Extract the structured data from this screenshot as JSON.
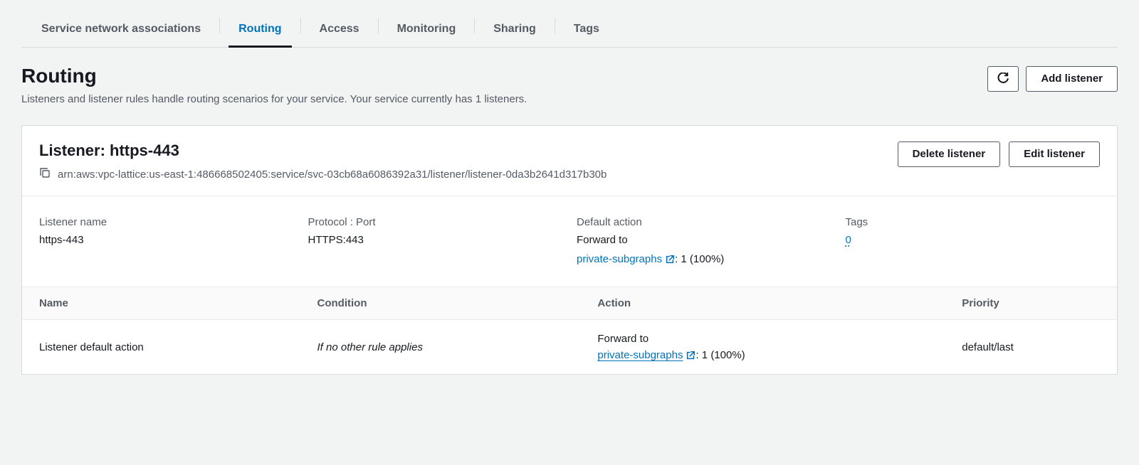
{
  "tabs": {
    "items": [
      {
        "label": "Service network associations"
      },
      {
        "label": "Routing"
      },
      {
        "label": "Access"
      },
      {
        "label": "Monitoring"
      },
      {
        "label": "Sharing"
      },
      {
        "label": "Tags"
      }
    ],
    "active_index": 1
  },
  "section": {
    "title": "Routing",
    "subtitle": "Listeners and listener rules handle routing scenarios for your service. Your service currently has 1 listeners.",
    "refresh_label": "Refresh",
    "add_label": "Add listener"
  },
  "listener": {
    "title_prefix": "Listener: ",
    "title_value": "https-443",
    "arn": "arn:aws:vpc-lattice:us-east-1:486668502405:service/svc-03cb68a6086392a31/listener/listener-0da3b2641d317b30b",
    "delete_label": "Delete listener",
    "edit_label": "Edit listener",
    "details": {
      "name_label": "Listener name",
      "name_value": "https-443",
      "protocol_label": "Protocol : Port",
      "protocol_value": "HTTPS:443",
      "default_action_label": "Default action",
      "forward_to_label": "Forward to",
      "forward_target": "private-subgraphs",
      "forward_suffix": ": 1 (100%)",
      "tags_label": "Tags",
      "tags_value": "0"
    },
    "rules": {
      "columns": {
        "name": "Name",
        "condition": "Condition",
        "action": "Action",
        "priority": "Priority"
      },
      "rows": [
        {
          "name": "Listener default action",
          "condition": "If no other rule applies",
          "action_forward_to": "Forward to",
          "action_target": "private-subgraphs",
          "action_suffix": ": 1 (100%)",
          "priority": "default/last"
        }
      ]
    }
  }
}
